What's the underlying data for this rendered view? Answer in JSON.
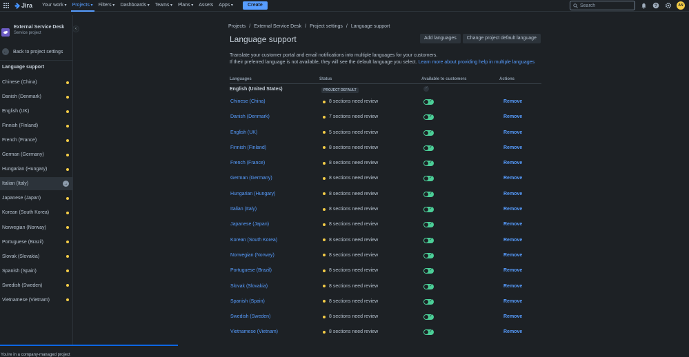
{
  "topbar": {
    "logo": "Jira",
    "nav": [
      "Your work",
      "Projects",
      "Filters",
      "Dashboards",
      "Teams",
      "Plans",
      "Assets",
      "Apps"
    ],
    "nav_dropdown": [
      true,
      true,
      true,
      true,
      true,
      true,
      false,
      true
    ],
    "active_nav": "Projects",
    "create": "Create",
    "search_placeholder": "Search",
    "avatar_initials": "AN"
  },
  "sidebar": {
    "project_name": "External Service Desk",
    "project_type": "Service project",
    "back": "Back to project settings",
    "heading": "Language support",
    "items": [
      "Chinese (China)",
      "Danish (Denmark)",
      "English (UK)",
      "Finnish (Finland)",
      "French (France)",
      "German (Germany)",
      "Hungarian (Hungary)",
      "Italian (Italy)",
      "Japanese (Japan)",
      "Korean (South Korea)",
      "Norwegian (Norway)",
      "Portuguese (Brazil)",
      "Slovak (Slovakia)",
      "Spanish (Spain)",
      "Swedish (Sweden)",
      "Vietnamese (Vietnam)"
    ],
    "active_item": "Italian (Italy)",
    "footer": "You're in a company-managed project"
  },
  "breadcrumbs": [
    "Projects",
    "External Service Desk",
    "Project settings",
    "Language support"
  ],
  "page": {
    "title": "Language support",
    "add_languages": "Add languages",
    "change_default": "Change project default language",
    "desc_line1": "Translate your customer portal and email notifications into multiple languages for your customers.",
    "desc_line2": "If their preferred language is not available, they will see the default language you select.",
    "learn_more": "Learn more about providing help in multiple languages"
  },
  "table": {
    "headers": {
      "languages": "Languages",
      "status": "Status",
      "available": "Available to customers",
      "actions": "Actions"
    },
    "default_row": {
      "language": "English (United States)",
      "badge": "PROJECT DEFAULT"
    },
    "remove_label": "Remove",
    "rows": [
      {
        "language": "Chinese (China)",
        "status": "8 sections need review"
      },
      {
        "language": "Danish (Denmark)",
        "status": "7 sections need review"
      },
      {
        "language": "English (UK)",
        "status": "5 sections need review"
      },
      {
        "language": "Finnish (Finland)",
        "status": "8 sections need review"
      },
      {
        "language": "French (France)",
        "status": "8 sections need review"
      },
      {
        "language": "German (Germany)",
        "status": "8 sections need review"
      },
      {
        "language": "Hungarian (Hungary)",
        "status": "8 sections need review"
      },
      {
        "language": "Italian (Italy)",
        "status": "8 sections need review"
      },
      {
        "language": "Japanese (Japan)",
        "status": "8 sections need review"
      },
      {
        "language": "Korean (South Korea)",
        "status": "8 sections need review"
      },
      {
        "language": "Norwegian (Norway)",
        "status": "8 sections need review"
      },
      {
        "language": "Portuguese (Brazil)",
        "status": "8 sections need review"
      },
      {
        "language": "Slovak (Slovakia)",
        "status": "8 sections need review"
      },
      {
        "language": "Spanish (Spain)",
        "status": "8 sections need review"
      },
      {
        "language": "Swedish (Sweden)",
        "status": "8 sections need review"
      },
      {
        "language": "Vietnamese (Vietnam)",
        "status": "8 sections need review"
      }
    ]
  },
  "colors": {
    "background": "#1d2125",
    "link": "#579dff",
    "warning_dot": "#f5cd47",
    "toggle_on": "#4bce97",
    "project_icon": "#6e5dc6"
  }
}
